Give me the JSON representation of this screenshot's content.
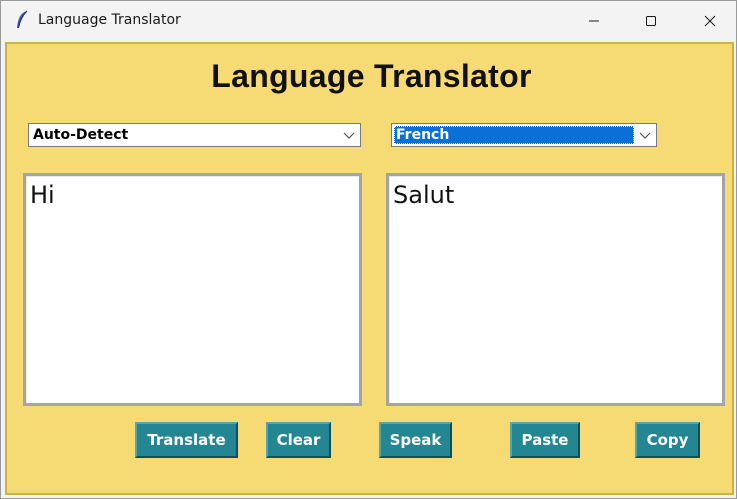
{
  "window": {
    "title": "Language Translator",
    "icon": "feather-icon"
  },
  "app": {
    "heading": "Language Translator",
    "source_language": "Auto-Detect",
    "target_language": "French",
    "source_text": "Hi",
    "translated_text": "Salut",
    "buttons": {
      "translate": "Translate",
      "clear": "Clear",
      "speak": "Speak",
      "paste": "Paste",
      "copy": "Copy"
    }
  },
  "colors": {
    "background": "#f6da74",
    "button": "#248593",
    "selection": "#0a70d8"
  }
}
